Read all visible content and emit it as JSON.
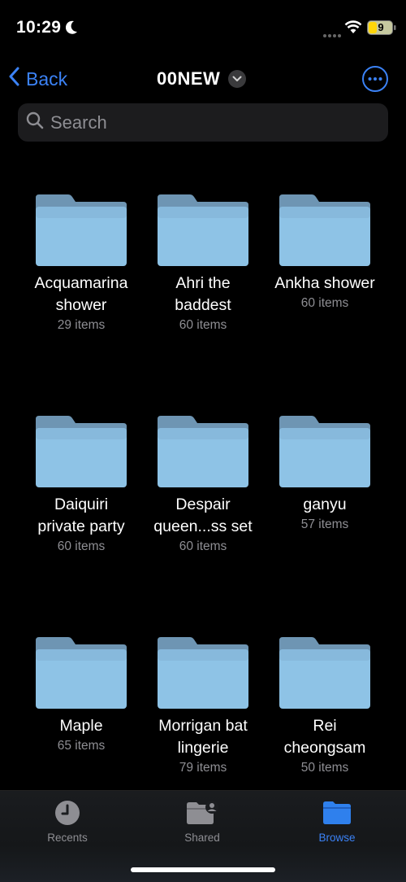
{
  "status": {
    "time": "10:29",
    "battery": "9"
  },
  "nav": {
    "back_label": "Back",
    "title": "00NEW"
  },
  "search": {
    "placeholder": "Search"
  },
  "folders": [
    {
      "line1": "Acquamarina",
      "line2": "shower",
      "count": "29 items"
    },
    {
      "line1": "Ahri the",
      "line2": "baddest",
      "count": "60 items"
    },
    {
      "line1": "Ankha shower",
      "line2": "",
      "count": "60 items"
    },
    {
      "line1": "Daiquiri",
      "line2": "private party",
      "count": "60 items"
    },
    {
      "line1": "Despair",
      "line2": "queen...ss set",
      "count": "60 items"
    },
    {
      "line1": "ganyu",
      "line2": "",
      "count": "57 items"
    },
    {
      "line1": "Maple",
      "line2": "",
      "count": "65 items"
    },
    {
      "line1": "Morrigan bat",
      "line2": "lingerie",
      "count": "79 items"
    },
    {
      "line1": "Rei",
      "line2": "cheongsam",
      "count": "50 items"
    }
  ],
  "tabs": [
    {
      "label": "Recents",
      "icon": "clock-icon"
    },
    {
      "label": "Shared",
      "icon": "shared-folder-icon"
    },
    {
      "label": "Browse",
      "icon": "folder-icon"
    }
  ],
  "colors": {
    "accent": "#3b82f6",
    "folder_body": "#8ec3e6",
    "folder_tab": "#6e95b3"
  }
}
